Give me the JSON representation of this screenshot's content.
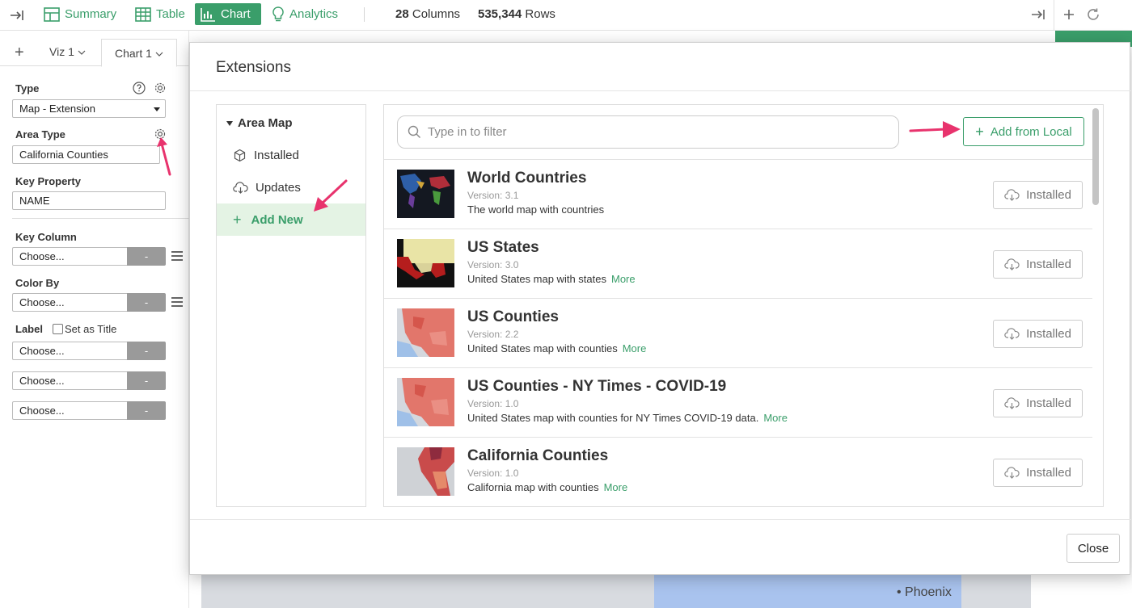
{
  "toolbar": {
    "summary_label": "Summary",
    "table_label": "Table",
    "chart_label": "Chart",
    "analytics_label": "Analytics",
    "columns_count": "28",
    "columns_label": "Columns",
    "rows_count": "535,344",
    "rows_label": "Rows"
  },
  "viz_panel": {
    "tabs": [
      {
        "label": "Viz 1"
      },
      {
        "label": "Chart 1"
      }
    ],
    "type_label": "Type",
    "type_value": "Map - Extension",
    "area_type_label": "Area Type",
    "area_type_value": "California Counties",
    "key_property_label": "Key Property",
    "key_property_value": "NAME",
    "key_column_label": "Key Column",
    "key_column_value": "Choose...",
    "color_by_label": "Color By",
    "color_by_value": "Choose...",
    "label_label": "Label",
    "set_as_title_label": "Set as Title",
    "label_choose_1": "Choose...",
    "label_choose_2": "Choose...",
    "label_choose_3": "Choose...",
    "dash": "-"
  },
  "map_background": {
    "city_label": "• Phoenix"
  },
  "modal": {
    "title": "Extensions",
    "nav": {
      "section_label": "Area Map",
      "installed_label": "Installed",
      "updates_label": "Updates",
      "add_new_label": "Add New"
    },
    "filter_placeholder": "Type in to filter",
    "add_from_local_label": "Add from Local",
    "extensions": [
      {
        "name": "World Countries",
        "version": "Version: 3.1",
        "description": "The world map with countries",
        "more": "",
        "status": "Installed"
      },
      {
        "name": "US States",
        "version": "Version: 3.0",
        "description": "United States map with states",
        "more": "More",
        "status": "Installed"
      },
      {
        "name": "US Counties",
        "version": "Version: 2.2",
        "description": "United States map with counties",
        "more": "More",
        "status": "Installed"
      },
      {
        "name": "US Counties - NY Times - COVID-19",
        "version": "Version: 1.0",
        "description": "United States map with counties for NY Times COVID-19 data.",
        "more": "More",
        "status": "Installed"
      },
      {
        "name": "California Counties",
        "version": "Version: 1.0",
        "description": "California map with counties",
        "more": "More",
        "status": "Installed"
      }
    ],
    "close_label": "Close"
  },
  "colors": {
    "accent_green": "#3a9e6a",
    "annotation_pink": "#e8336d",
    "selected_nav_bg": "#e4f3e4"
  }
}
